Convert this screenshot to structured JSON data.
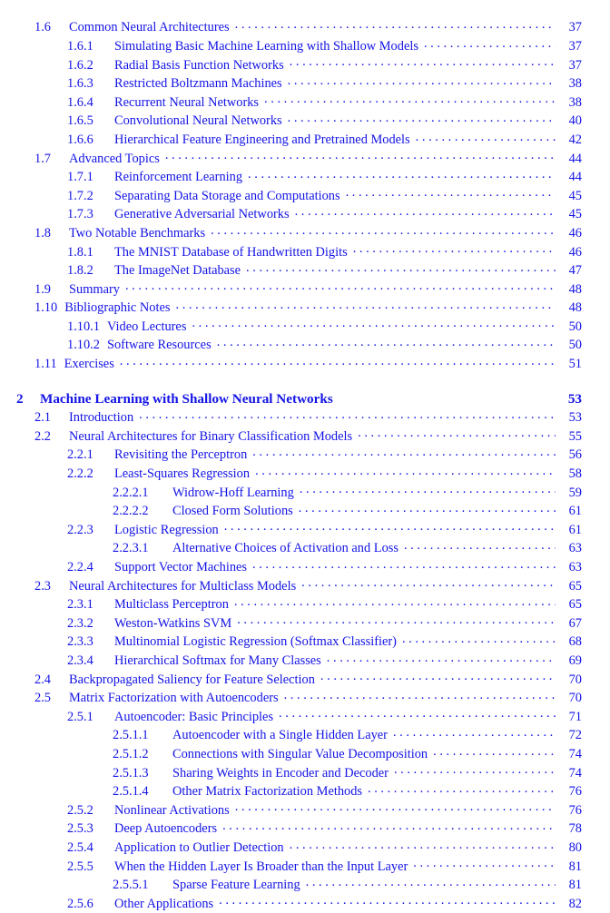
{
  "document": {
    "kind": "table-of-contents",
    "text_color": "#1414e6",
    "page_number_color": "#1414e6"
  },
  "entries": [
    {
      "level": 1,
      "number": "1.6",
      "title": "Common Neural Architectures",
      "page": "37"
    },
    {
      "level": 2,
      "number": "1.6.1",
      "title": "Simulating Basic Machine Learning with Shallow Models",
      "page": "37"
    },
    {
      "level": 2,
      "number": "1.6.2",
      "title": "Radial Basis Function Networks",
      "page": "37"
    },
    {
      "level": 2,
      "number": "1.6.3",
      "title": "Restricted Boltzmann Machines",
      "page": "38"
    },
    {
      "level": 2,
      "number": "1.6.4",
      "title": "Recurrent Neural Networks",
      "page": "38"
    },
    {
      "level": 2,
      "number": "1.6.5",
      "title": "Convolutional Neural Networks",
      "page": "40"
    },
    {
      "level": 2,
      "number": "1.6.6",
      "title": "Hierarchical Feature Engineering and Pretrained Models",
      "page": "42"
    },
    {
      "level": 1,
      "number": "1.7",
      "title": "Advanced Topics",
      "page": "44"
    },
    {
      "level": 2,
      "number": "1.7.1",
      "title": "Reinforcement Learning",
      "page": "44"
    },
    {
      "level": 2,
      "number": "1.7.2",
      "title": "Separating Data Storage and Computations",
      "page": "45"
    },
    {
      "level": 2,
      "number": "1.7.3",
      "title": "Generative Adversarial Networks",
      "page": "45"
    },
    {
      "level": 1,
      "number": "1.8",
      "title": "Two Notable Benchmarks",
      "page": "46"
    },
    {
      "level": 2,
      "number": "1.8.1",
      "title": "The MNIST Database of Handwritten Digits",
      "page": "46"
    },
    {
      "level": 2,
      "number": "1.8.2",
      "title": "The ImageNet Database",
      "page": "47"
    },
    {
      "level": 1,
      "number": "1.9",
      "title": "Summary",
      "page": "48"
    },
    {
      "level": 1,
      "number": "1.10",
      "title": "Bibliographic Notes",
      "page": "48",
      "tight": true
    },
    {
      "level": 2,
      "number": "1.10.1",
      "title": "Video Lectures",
      "page": "50",
      "tight": true
    },
    {
      "level": 2,
      "number": "1.10.2",
      "title": "Software Resources",
      "page": "50",
      "tight": true
    },
    {
      "level": 1,
      "number": "1.11",
      "title": "Exercises",
      "page": "51",
      "tight": true
    },
    {
      "level": 0,
      "number": "2",
      "title": "Machine Learning with Shallow Neural Networks",
      "page": "53",
      "gap_before": true
    },
    {
      "level": 1,
      "number": "2.1",
      "title": "Introduction",
      "page": "53"
    },
    {
      "level": 1,
      "number": "2.2",
      "title": "Neural Architectures for Binary Classification Models",
      "page": "55"
    },
    {
      "level": 2,
      "number": "2.2.1",
      "title": "Revisiting the Perceptron",
      "page": "56"
    },
    {
      "level": 2,
      "number": "2.2.2",
      "title": "Least-Squares Regression",
      "page": "58"
    },
    {
      "level": 3,
      "number": "2.2.2.1",
      "title": "Widrow-Hoff Learning",
      "page": "59"
    },
    {
      "level": 3,
      "number": "2.2.2.2",
      "title": "Closed Form Solutions",
      "page": "61"
    },
    {
      "level": 2,
      "number": "2.2.3",
      "title": "Logistic Regression",
      "page": "61"
    },
    {
      "level": 3,
      "number": "2.2.3.1",
      "title": "Alternative Choices of Activation and Loss",
      "page": "63"
    },
    {
      "level": 2,
      "number": "2.2.4",
      "title": "Support Vector Machines",
      "page": "63"
    },
    {
      "level": 1,
      "number": "2.3",
      "title": "Neural Architectures for Multiclass Models",
      "page": "65"
    },
    {
      "level": 2,
      "number": "2.3.1",
      "title": "Multiclass Perceptron",
      "page": "65"
    },
    {
      "level": 2,
      "number": "2.3.2",
      "title": "Weston-Watkins SVM",
      "page": "67"
    },
    {
      "level": 2,
      "number": "2.3.3",
      "title": "Multinomial Logistic Regression (Softmax Classifier)",
      "page": "68"
    },
    {
      "level": 2,
      "number": "2.3.4",
      "title": "Hierarchical Softmax for Many Classes",
      "page": "69"
    },
    {
      "level": 1,
      "number": "2.4",
      "title": "Backpropagated Saliency for Feature Selection",
      "page": "70"
    },
    {
      "level": 1,
      "number": "2.5",
      "title": "Matrix Factorization with Autoencoders",
      "page": "70"
    },
    {
      "level": 2,
      "number": "2.5.1",
      "title": "Autoencoder: Basic Principles",
      "page": "71"
    },
    {
      "level": 3,
      "number": "2.5.1.1",
      "title": "Autoencoder with a Single Hidden Layer",
      "page": "72"
    },
    {
      "level": 3,
      "number": "2.5.1.2",
      "title": "Connections with Singular Value Decomposition",
      "page": "74"
    },
    {
      "level": 3,
      "number": "2.5.1.3",
      "title": "Sharing Weights in Encoder and Decoder",
      "page": "74"
    },
    {
      "level": 3,
      "number": "2.5.1.4",
      "title": "Other Matrix Factorization Methods",
      "page": "76"
    },
    {
      "level": 2,
      "number": "2.5.2",
      "title": "Nonlinear Activations",
      "page": "76"
    },
    {
      "level": 2,
      "number": "2.5.3",
      "title": "Deep Autoencoders",
      "page": "78"
    },
    {
      "level": 2,
      "number": "2.5.4",
      "title": "Application to Outlier Detection",
      "page": "80"
    },
    {
      "level": 2,
      "number": "2.5.5",
      "title": "When the Hidden Layer Is Broader than the Input Layer",
      "page": "81"
    },
    {
      "level": 3,
      "number": "2.5.5.1",
      "title": "Sparse Feature Learning",
      "page": "81"
    },
    {
      "level": 2,
      "number": "2.5.6",
      "title": "Other Applications",
      "page": "82"
    }
  ]
}
